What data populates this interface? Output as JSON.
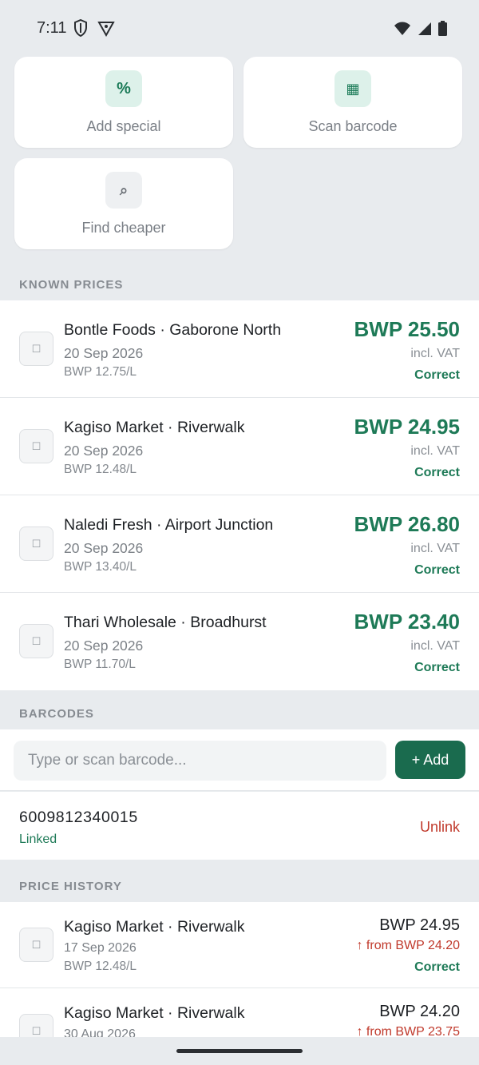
{
  "status": {
    "time": "7:11"
  },
  "actions": {
    "add_special": {
      "label": "Add special",
      "icon": "%"
    },
    "scan_barcode": {
      "label": "Scan barcode",
      "icon": "▦"
    },
    "find_cheaper": {
      "label": "Find cheaper",
      "icon": "⌕"
    }
  },
  "known_prices": {
    "header": "KNOWN PRICES",
    "items": [
      {
        "store": "Bontle Foods · Gaborone North",
        "date": "20 Sep 2026",
        "unit": "BWP 12.75/L",
        "price": "BWP 25.50",
        "vat": "incl. VAT",
        "status": "Correct"
      },
      {
        "store": "Kagiso Market · Riverwalk",
        "date": "20 Sep 2026",
        "unit": "BWP 12.48/L",
        "price": "BWP 24.95",
        "vat": "incl. VAT",
        "status": "Correct"
      },
      {
        "store": "Naledi Fresh · Airport Junction",
        "date": "20 Sep 2026",
        "unit": "BWP 13.40/L",
        "price": "BWP 26.80",
        "vat": "incl. VAT",
        "status": "Correct"
      },
      {
        "store": "Thari Wholesale · Broadhurst",
        "date": "20 Sep 2026",
        "unit": "BWP 11.70/L",
        "price": "BWP 23.40",
        "vat": "incl. VAT",
        "status": "Correct"
      }
    ]
  },
  "barcodes": {
    "header": "BARCODES",
    "input_placeholder": "Type or scan barcode...",
    "add_label": "+ Add",
    "items": [
      {
        "code": "6009812340015",
        "status": "Linked",
        "action": "Unlink"
      }
    ]
  },
  "price_history": {
    "header": "PRICE HISTORY",
    "items": [
      {
        "store": "Kagiso Market · Riverwalk",
        "date": "17 Sep 2026",
        "unit": "BWP 12.48/L",
        "price": "BWP 24.95",
        "change": "↑ from BWP 24.20",
        "status": "Correct"
      },
      {
        "store": "Kagiso Market · Riverwalk",
        "date": "30 Aug 2026",
        "unit": "",
        "price": "BWP 24.20",
        "change": "↑ from BWP 23.75",
        "status": ""
      }
    ]
  },
  "colors": {
    "accent": "#1e7a57",
    "danger": "#c0392b",
    "background": "#e8ebee"
  }
}
